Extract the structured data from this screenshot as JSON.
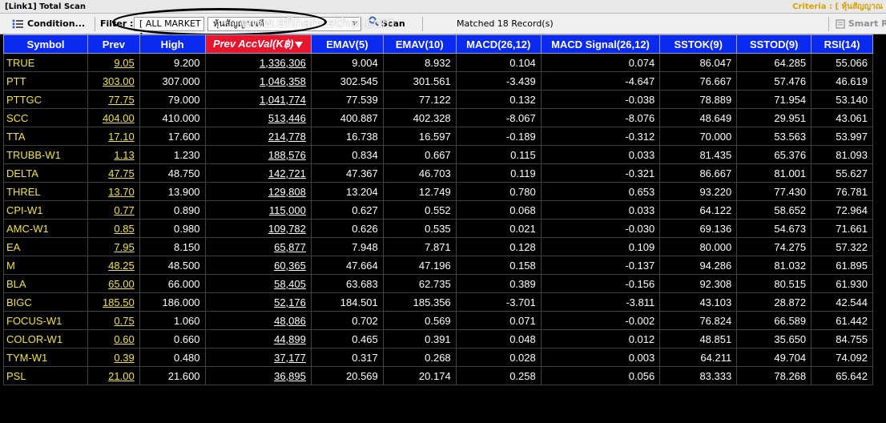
{
  "window": {
    "title": "[Link1] Total Scan",
    "criteria": "Criteria : [ หุ้นสัญญาณ"
  },
  "toolbar": {
    "condition_label": "Condition...",
    "filter_label": "Filter :",
    "market_value": "[ ALL MARKET ]",
    "thai_filter_value": "หุ้นสัญญาณดี",
    "scan_label": "Scan",
    "matched_text": "Matched 18 Record(s)",
    "smart_label": "Smart Ra",
    "watermark": "www.efinancethai.com"
  },
  "icons": {
    "condition": "condition-list-icon",
    "scan": "magnifier-icon",
    "smart": "smart-icon",
    "sort": "sort-descending-icon"
  },
  "colors": {
    "header_bg": "#0a2aef",
    "sorted_header_bg": "#e8152f",
    "symbol_text": "#f2e33a",
    "value_text": "#ffffff",
    "grid_bg": "#000000"
  },
  "columns": [
    "Symbol",
    "Prev",
    "High",
    "Prev AccVal(K฿)",
    "EMAV(5)",
    "EMAV(10)",
    "MACD(26,12)",
    "MACD Signal(26,12)",
    "SSTOK(9)",
    "SSTOD(9)",
    "RSI(14)"
  ],
  "rows": [
    [
      "TRUE",
      "9.05",
      "9.200",
      "1,336,306",
      "9.004",
      "8.932",
      "0.104",
      "0.074",
      "86.047",
      "64.285",
      "55.066"
    ],
    [
      "PTT",
      "303.00",
      "307.000",
      "1,046,358",
      "302.545",
      "301.561",
      "-3.439",
      "-4.647",
      "76.667",
      "57.476",
      "46.619"
    ],
    [
      "PTTGC",
      "77.75",
      "79.000",
      "1,041,774",
      "77.539",
      "77.122",
      "0.132",
      "-0.038",
      "78.889",
      "71.954",
      "53.140"
    ],
    [
      "SCC",
      "404.00",
      "410.000",
      "513,446",
      "400.887",
      "402.328",
      "-8.067",
      "-8.076",
      "48.649",
      "29.951",
      "43.061"
    ],
    [
      "TTA",
      "17.10",
      "17.600",
      "214,778",
      "16.738",
      "16.597",
      "-0.189",
      "-0.312",
      "70.000",
      "53.563",
      "53.997"
    ],
    [
      "TRUBB-W1",
      "1.13",
      "1.230",
      "188,576",
      "0.834",
      "0.667",
      "0.115",
      "0.033",
      "81.435",
      "65.376",
      "81.093"
    ],
    [
      "DELTA",
      "47.75",
      "48.750",
      "142,721",
      "47.367",
      "46.703",
      "0.119",
      "-0.321",
      "86.667",
      "81.001",
      "55.627"
    ],
    [
      "THREL",
      "13.70",
      "13.900",
      "129,808",
      "13.204",
      "12.749",
      "0.780",
      "0.653",
      "93.220",
      "77.430",
      "76.781"
    ],
    [
      "CPI-W1",
      "0.77",
      "0.890",
      "115,000",
      "0.627",
      "0.552",
      "0.068",
      "0.033",
      "64.122",
      "58.652",
      "72.964"
    ],
    [
      "AMC-W1",
      "0.85",
      "0.980",
      "109,782",
      "0.626",
      "0.535",
      "0.021",
      "-0.030",
      "69.136",
      "54.673",
      "71.661"
    ],
    [
      "EA",
      "7.95",
      "8.150",
      "65,877",
      "7.948",
      "7.871",
      "0.128",
      "0.109",
      "80.000",
      "74.275",
      "57.322"
    ],
    [
      "M",
      "48.25",
      "48.500",
      "60,365",
      "47.664",
      "47.196",
      "0.158",
      "-0.137",
      "94.286",
      "81.032",
      "61.895"
    ],
    [
      "BLA",
      "65.00",
      "66.000",
      "58,405",
      "63.683",
      "62.735",
      "0.389",
      "-0.156",
      "92.308",
      "80.515",
      "61.930"
    ],
    [
      "BIGC",
      "185.50",
      "186.000",
      "52,176",
      "184.501",
      "185.356",
      "-3.701",
      "-3.811",
      "43.103",
      "28.872",
      "42.544"
    ],
    [
      "FOCUS-W1",
      "0.75",
      "1.060",
      "48,086",
      "0.702",
      "0.569",
      "0.071",
      "-0.002",
      "76.824",
      "66.589",
      "61.442"
    ],
    [
      "COLOR-W1",
      "0.60",
      "0.660",
      "44,899",
      "0.465",
      "0.391",
      "0.048",
      "0.012",
      "48.851",
      "35.650",
      "84.755"
    ],
    [
      "TYM-W1",
      "0.39",
      "0.480",
      "37,177",
      "0.317",
      "0.268",
      "0.028",
      "0.003",
      "64.211",
      "49.704",
      "74.092"
    ],
    [
      "PSL",
      "21.00",
      "21.600",
      "36,895",
      "20.569",
      "20.174",
      "0.258",
      "0.056",
      "83.333",
      "78.268",
      "65.642"
    ]
  ]
}
